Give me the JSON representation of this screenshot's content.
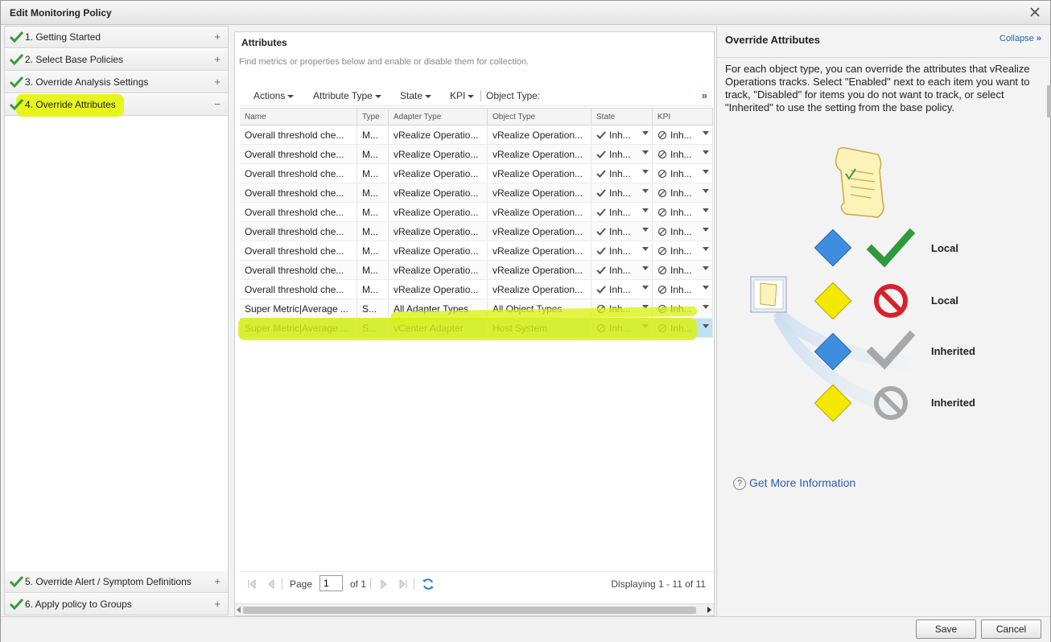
{
  "dialog": {
    "title": "Edit Monitoring Policy"
  },
  "wizard": {
    "steps": [
      {
        "label": "1. Getting Started",
        "toggle": "+"
      },
      {
        "label": "2. Select Base Policies",
        "toggle": "+"
      },
      {
        "label": "3. Override Analysis Settings",
        "toggle": "+"
      },
      {
        "label": "4. Override Attributes",
        "toggle": "−"
      },
      {
        "label": "5. Override Alert / Symptom Definitions",
        "toggle": "+"
      },
      {
        "label": "6. Apply policy to Groups",
        "toggle": "+"
      }
    ]
  },
  "attributes": {
    "title": "Attributes",
    "description": "Find metrics or properties below and enable or disable them for collection.",
    "toolbar": {
      "actions": "Actions",
      "attribute_type": "Attribute Type",
      "state": "State",
      "kpi": "KPI",
      "object_type": "Object Type:",
      "expand": "»"
    },
    "columns": [
      "Name",
      "Type",
      "Adapter Type",
      "Object Type",
      "State",
      "KPI"
    ],
    "rows": [
      {
        "name": "Overall threshold che...",
        "type": "M...",
        "adapter": "vRealize Operatio...",
        "object": "vRealize Operation...",
        "state": "Inh...",
        "kpi": "Inh...",
        "state_icon": "check"
      },
      {
        "name": "Overall threshold che...",
        "type": "M...",
        "adapter": "vRealize Operatio...",
        "object": "vRealize Operation...",
        "state": "Inh...",
        "kpi": "Inh...",
        "state_icon": "check"
      },
      {
        "name": "Overall threshold che...",
        "type": "M...",
        "adapter": "vRealize Operatio...",
        "object": "vRealize Operation...",
        "state": "Inh...",
        "kpi": "Inh...",
        "state_icon": "check"
      },
      {
        "name": "Overall threshold che...",
        "type": "M...",
        "adapter": "vRealize Operatio...",
        "object": "vRealize Operation...",
        "state": "Inh...",
        "kpi": "Inh...",
        "state_icon": "check"
      },
      {
        "name": "Overall threshold che...",
        "type": "M...",
        "adapter": "vRealize Operatio...",
        "object": "vRealize Operation...",
        "state": "Inh...",
        "kpi": "Inh...",
        "state_icon": "check"
      },
      {
        "name": "Overall threshold che...",
        "type": "M...",
        "adapter": "vRealize Operatio...",
        "object": "vRealize Operation...",
        "state": "Inh...",
        "kpi": "Inh...",
        "state_icon": "check"
      },
      {
        "name": "Overall threshold che...",
        "type": "M...",
        "adapter": "vRealize Operatio...",
        "object": "vRealize Operation...",
        "state": "Inh...",
        "kpi": "Inh...",
        "state_icon": "check"
      },
      {
        "name": "Overall threshold che...",
        "type": "M...",
        "adapter": "vRealize Operatio...",
        "object": "vRealize Operation...",
        "state": "Inh...",
        "kpi": "Inh...",
        "state_icon": "check"
      },
      {
        "name": "Overall threshold che...",
        "type": "M...",
        "adapter": "vRealize Operatio...",
        "object": "vRealize Operation...",
        "state": "Inh...",
        "kpi": "Inh...",
        "state_icon": "check"
      },
      {
        "name": "Super Metric|Average ...",
        "type": "S...",
        "adapter": "All Adapter Types",
        "object": "All Object Types",
        "state": "Inh...",
        "kpi": "Inh...",
        "state_icon": "disabled"
      },
      {
        "name": "Super Metric|Average ...",
        "type": "S...",
        "adapter": "vCenter Adapter",
        "object": "Host System",
        "state": "Inh...",
        "kpi": "Inh...",
        "state_icon": "disabled",
        "selected": true
      }
    ],
    "pager": {
      "page_label": "Page",
      "page_value": "1",
      "of_label": "of 1",
      "displaying": "Displaying 1 - 11 of 11"
    }
  },
  "override_panel": {
    "title": "Override Attributes",
    "collapse": "Collapse",
    "collapse_icon": "»",
    "description": "For each object type, you can override the attributes that vRealize Operations tracks. Select \"Enabled\" next to each item you want to track, \"Disabled\" for items you do not want to track, or select \"Inherited\" to use the setting from the base policy.",
    "legend": [
      {
        "label": "Local"
      },
      {
        "label": "Local"
      },
      {
        "label": "Inherited"
      },
      {
        "label": "Inherited"
      }
    ],
    "help_link": "Get More Information",
    "colors": {
      "blue_diamond": "#3e8ee0",
      "yellow_diamond": "#f5e800",
      "green_check": "#2e9a3a",
      "red_no": "#d8202a",
      "grey": "#a8a8a8"
    }
  },
  "footer": {
    "save": "Save",
    "cancel": "Cancel"
  }
}
